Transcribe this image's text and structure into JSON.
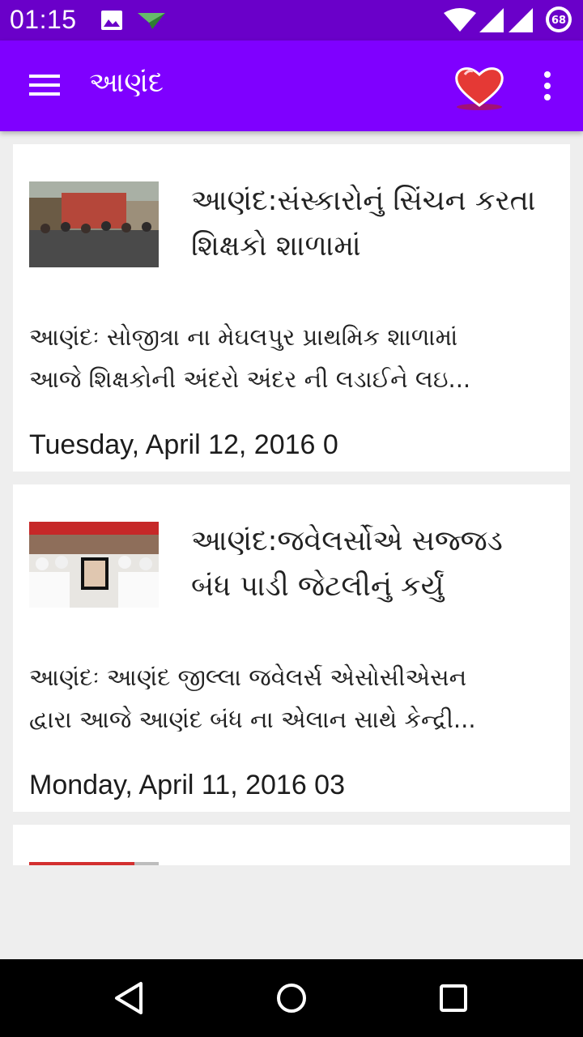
{
  "status": {
    "time": "01:15",
    "battery_level": "68"
  },
  "appbar": {
    "title": "આણંદ"
  },
  "articles": [
    {
      "headline": "આણંદ:સંસ્કારોનું સિંચન કરતા શિક્ષકો શાળામાં",
      "summary_line1": "આણંદઃ સોજીત્રા ના મેઘલપુર પ્રાથમિક શાળામાં",
      "summary_line2": "આજે શિક્ષકોની અંદરો અંદર ની લડાઈને લઇ...",
      "date": "Tuesday, April 12, 2016 0"
    },
    {
      "headline": "આણંદ:જવેલર્સોએ સજ્જડ બંધ પાડી જેટલીનું કર્યું",
      "summary_line1": "આણંદઃ આણંદ જીલ્લા જવેલર્સ એસોસીએસન",
      "summary_line2": "દ્વારા આજે આણંદ બંધ ના એલાન સાથે કેન્દ્રી...",
      "date": "Monday, April 11, 2016 03"
    }
  ],
  "colors": {
    "status_bar": "#6a00c9",
    "app_bar": "#7f00ff",
    "heart": "#e53935"
  }
}
